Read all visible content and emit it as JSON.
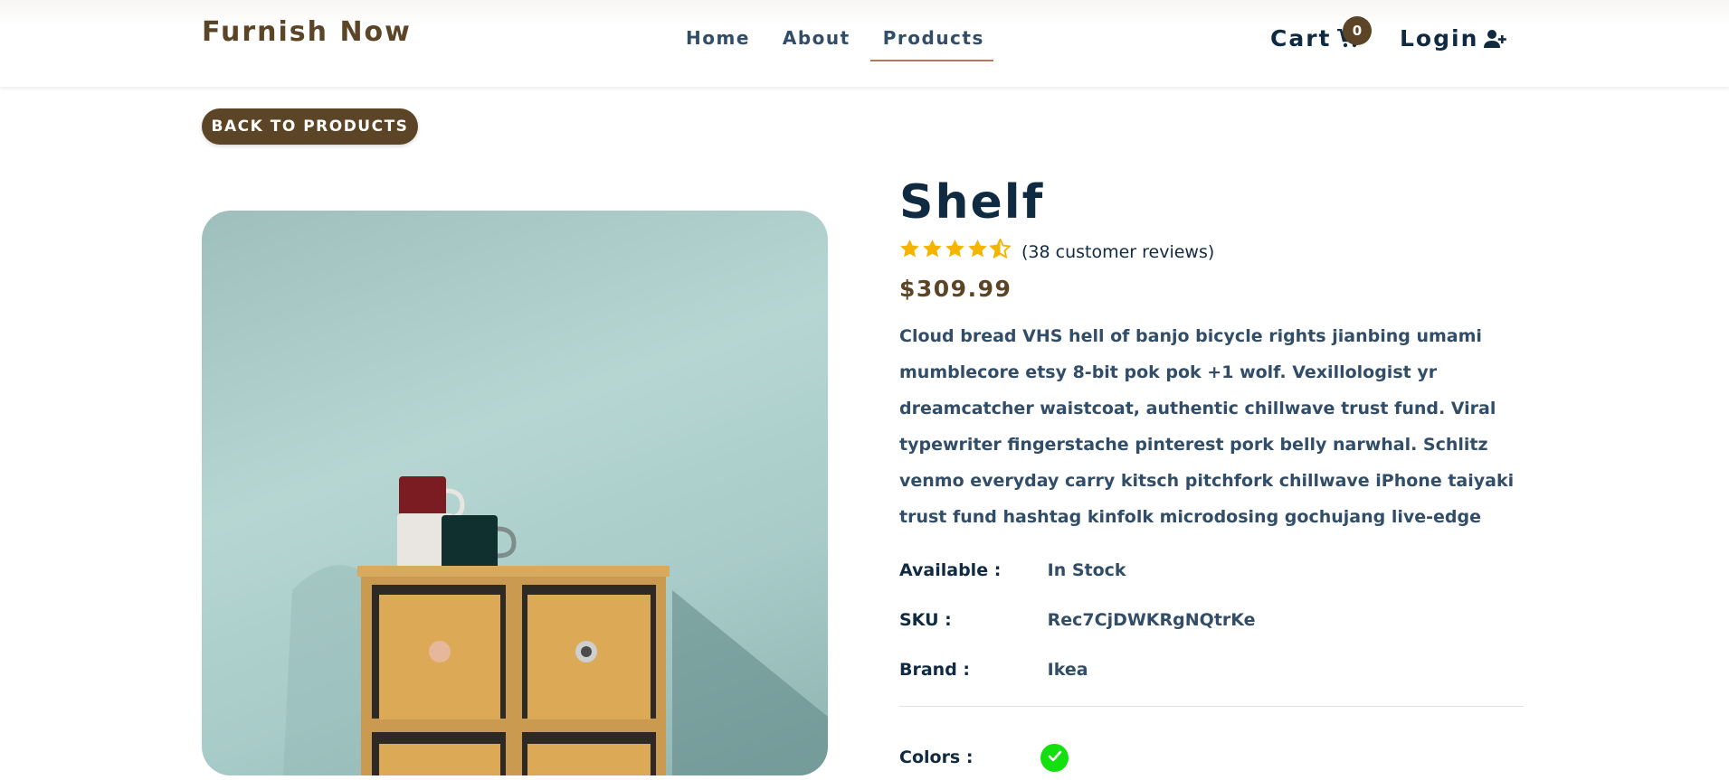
{
  "brand": "Furnish Now",
  "nav": {
    "links": [
      {
        "label": "Home"
      },
      {
        "label": "About"
      },
      {
        "label": "Products"
      }
    ],
    "cart_label": "Cart",
    "cart_count": "0",
    "login_label": "Login"
  },
  "back_button": "BACK TO PRODUCTS",
  "product": {
    "name": "Shelf",
    "rating": 4.5,
    "rating_max": 5,
    "reviews_text": "(38 customer reviews)",
    "price": "$309.99",
    "description": "Cloud bread VHS hell of banjo bicycle rights jianbing umami mumblecore etsy 8-bit pok pok +1 wolf. Vexillologist yr dreamcatcher waistcoat, authentic chillwave trust fund. Viral typewriter fingerstache pinterest pork belly narwhal. Schlitz venmo everyday carry kitsch pitchfork chillwave iPhone taiyaki trust fund hashtag kinfolk microdosing gochujang live-edge",
    "available_label": "Available :",
    "available_value": "In Stock",
    "sku_label": "SKU :",
    "sku_value": "Rec7CjDWKRgNQtrKe",
    "brand_label": "Brand :",
    "brand_value": "Ikea",
    "colors_label": "Colors :",
    "color_selected": "#14e010"
  },
  "icons": {
    "cart": "cart-icon",
    "login": "user-plus-icon",
    "star": "star-icon",
    "check": "check-icon"
  },
  "colors": {
    "brand_brown": "#5c4426",
    "accent": "#ab7a5f",
    "star": "#f5b400",
    "text_dark": "#102a42"
  }
}
